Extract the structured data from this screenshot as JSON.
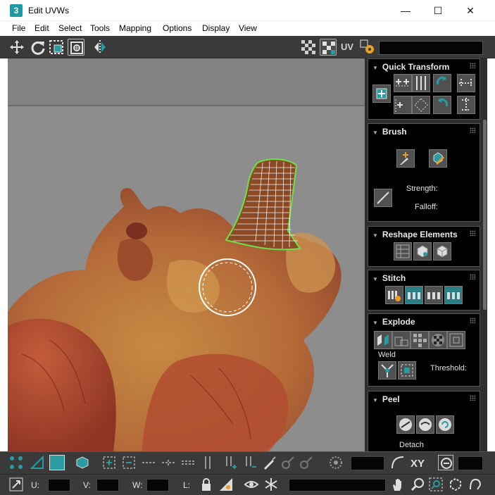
{
  "window": {
    "title": "Edit UVWs",
    "icon_glyph": "3",
    "minimize": "—",
    "maximize": "☐",
    "close": "✕"
  },
  "menu": [
    "File",
    "Edit",
    "Select",
    "Tools",
    "Mapping",
    "Options",
    "Display",
    "View"
  ],
  "toolbar": {
    "uv_label": "UV",
    "icons": [
      "move-icon",
      "rotate-icon",
      "scale-icon",
      "freeform-icon",
      "mirror-icon",
      "checker-pattern-icon",
      "checker-texture-icon",
      "uv-icon",
      "settings-icon"
    ]
  },
  "rollouts": {
    "quick_transform": {
      "title": "Quick Transform"
    },
    "brush": {
      "title": "Brush",
      "strength_label": "Strength:",
      "falloff_label": "Falloff:"
    },
    "reshape": {
      "title": "Reshape Elements"
    },
    "stitch": {
      "title": "Stitch"
    },
    "explode": {
      "title": "Explode",
      "weld_label": "Weld",
      "threshold_label": "Threshold:"
    },
    "peel": {
      "title": "Peel",
      "detach_label": "Detach"
    }
  },
  "status": {
    "u_label": "U:",
    "v_label": "V:",
    "w_label": "W:",
    "l_label": "L:",
    "xy_label": "XY"
  },
  "colors": {
    "accent_teal": "#2a9aa3",
    "panel_bg": "#2e2e2e",
    "uv_mesh_green": "#6ee04a"
  }
}
